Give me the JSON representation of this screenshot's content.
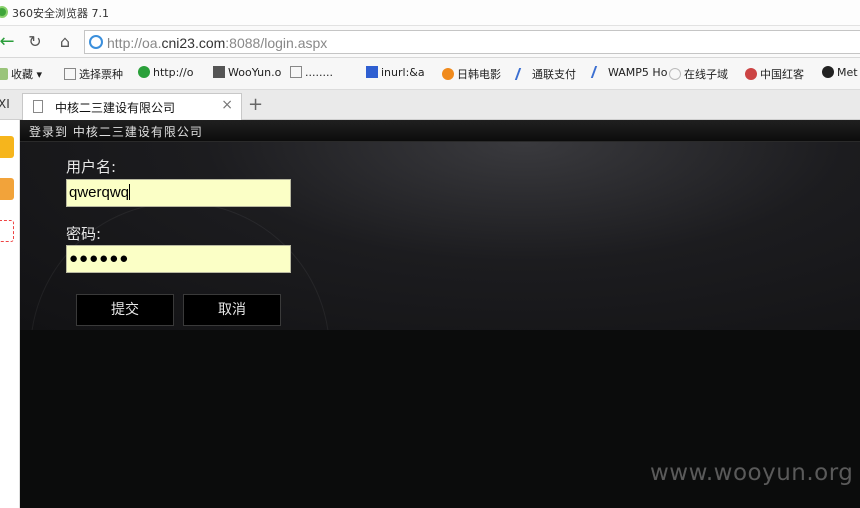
{
  "window": {
    "title": "360安全浏览器 7.1"
  },
  "nav": {
    "url_host": "http://oa.",
    "url_domain": "cni23.com",
    "url_rest": ":8088/login.aspx"
  },
  "bookmarks": {
    "favorites": "收藏",
    "items": [
      "选择票种",
      "http://o",
      "WooYun.o",
      "........",
      "inurl:&a",
      "日韩电影",
      "通联支付",
      "WAMP5 Ho",
      "在线子域",
      "中国红客",
      "Met"
    ]
  },
  "tab": {
    "prefix": "XI",
    "title": "中核二三建设有限公司"
  },
  "page": {
    "header": "登录到 中核二三建设有限公司",
    "username_label": "用户名:",
    "username_value": "qwerqwq",
    "password_label": "密码:",
    "password_value": "●●●●●●",
    "submit_label": "提交",
    "cancel_label": "取消"
  },
  "watermark": "www.wooyun.org",
  "icons": {
    "browser_logo": "360-logo-icon",
    "back": "back-arrow-icon",
    "refresh": "refresh-icon",
    "home": "home-icon",
    "globe": "globe-icon",
    "doc": "document-icon",
    "close": "close-icon",
    "plus": "plus-icon"
  },
  "colors": {
    "field_bg": "#fbffc6",
    "page_bg": "#0b0c0c",
    "accent_green": "#2a9d3a"
  }
}
